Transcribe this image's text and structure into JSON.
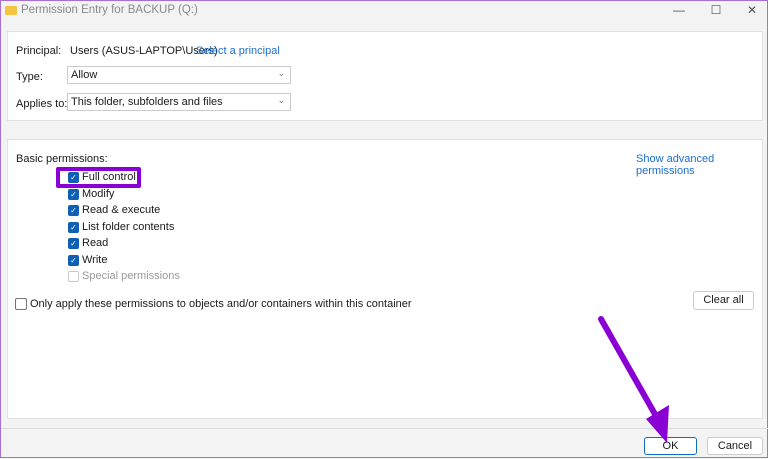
{
  "window": {
    "title": "Permission Entry for BACKUP (Q:)",
    "minimize": "—",
    "maximize": "☐",
    "close": "✕"
  },
  "principal": {
    "label": "Principal:",
    "value": "Users (ASUS-LAPTOP\\Users)",
    "link": "Select a principal"
  },
  "type": {
    "label": "Type:",
    "value": "Allow"
  },
  "applies": {
    "label": "Applies to:",
    "value": "This folder, subfolders and files"
  },
  "basic": {
    "label": "Basic permissions:",
    "advanced_link": "Show advanced permissions",
    "items": [
      {
        "label": "Full control",
        "checked": true,
        "enabled": true
      },
      {
        "label": "Modify",
        "checked": true,
        "enabled": true
      },
      {
        "label": "Read & execute",
        "checked": true,
        "enabled": true
      },
      {
        "label": "List folder contents",
        "checked": true,
        "enabled": true
      },
      {
        "label": "Read",
        "checked": true,
        "enabled": true
      },
      {
        "label": "Write",
        "checked": true,
        "enabled": true
      },
      {
        "label": "Special permissions",
        "checked": false,
        "enabled": false
      }
    ]
  },
  "only_apply": {
    "label": "Only apply these permissions to objects and/or containers within this container",
    "checked": false
  },
  "buttons": {
    "clear_all": "Clear all",
    "ok": "OK",
    "cancel": "Cancel"
  },
  "annotation_color": "#8a00d4"
}
